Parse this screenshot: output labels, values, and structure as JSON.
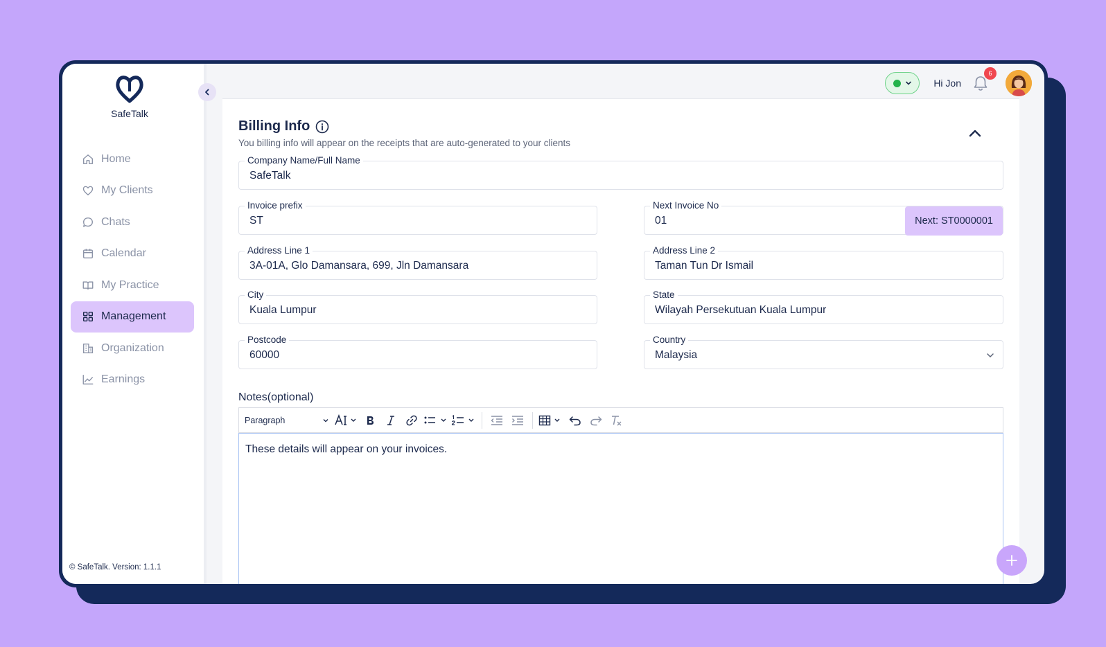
{
  "app": {
    "name": "SafeTalk",
    "version_text": "© SafeTalk. Version: 1.1.1"
  },
  "sidebar": {
    "items": [
      {
        "label": "Home",
        "icon": "home-icon",
        "active": false
      },
      {
        "label": "My Clients",
        "icon": "heart-icon",
        "active": false
      },
      {
        "label": "Chats",
        "icon": "chat-bubble-icon",
        "active": false
      },
      {
        "label": "Calendar",
        "icon": "calendar-icon",
        "active": false
      },
      {
        "label": "My Practice",
        "icon": "book-open-icon",
        "active": false
      },
      {
        "label": "Management",
        "icon": "grid-icon",
        "active": true
      },
      {
        "label": "Organization",
        "icon": "building-icon",
        "active": false
      },
      {
        "label": "Earnings",
        "icon": "line-chart-icon",
        "active": false
      }
    ]
  },
  "topbar": {
    "greeting": "Hi Jon",
    "notification_count": "6",
    "status_color": "#24b34b"
  },
  "billing": {
    "title": "Billing Info",
    "subtitle": "You billing info will appear on the receipts that are auto-generated to your clients",
    "company_label": "Company Name/Full Name",
    "company_value": "SafeTalk",
    "prefix_label": "Invoice prefix",
    "prefix_value": "ST",
    "next_label": "Next Invoice No",
    "next_value": "01",
    "next_preview": "Next: ST0000001",
    "address1_label": "Address Line 1",
    "address1_value": "3A-01A, Glo Damansara, 699, Jln Damansara",
    "address2_label": "Address Line 2",
    "address2_value": "Taman Tun Dr Ismail",
    "city_label": "City",
    "city_value": "Kuala Lumpur",
    "state_label": "State",
    "state_value": "Wilayah Persekutuan Kuala Lumpur",
    "postcode_label": "Postcode",
    "postcode_value": "60000",
    "country_label": "Country",
    "country_value": "Malaysia"
  },
  "notes": {
    "label": "Notes(optional)",
    "format_select": "Paragraph",
    "content": "These details will appear on your invoices."
  },
  "colors": {
    "accent": "#dcc5fc",
    "navy": "#14295a",
    "background": "#c4a6fb"
  }
}
